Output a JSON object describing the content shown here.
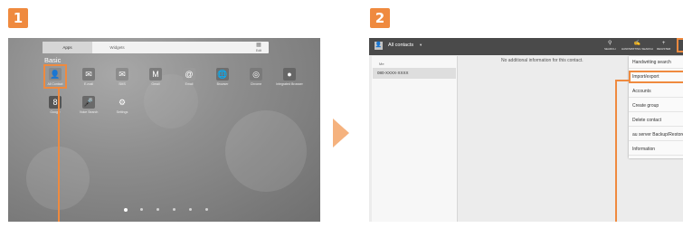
{
  "steps": [
    "1",
    "2"
  ],
  "home": {
    "tabs": [
      {
        "label": "Apps",
        "active": true
      },
      {
        "label": "Widgets",
        "active": false
      }
    ],
    "edit_label": "Edit",
    "section": "Basic",
    "apps_row1": [
      {
        "label": "All Contact",
        "icon": "contacts-icon",
        "glyph": "👤",
        "color": "#8a8a8a"
      },
      {
        "label": "E-mail",
        "icon": "email-icon",
        "glyph": "✉",
        "color": "#7a7a7a"
      },
      {
        "label": "SMS",
        "icon": "sms-icon",
        "glyph": "✉",
        "color": "#8c8c8c"
      },
      {
        "label": "Gmail",
        "icon": "gmail-icon",
        "glyph": "M",
        "color": "#7c7c7c"
      },
      {
        "label": "Email",
        "icon": "mail-icon",
        "glyph": "@",
        "color": "#9a9a9a"
      },
      {
        "label": "Browser",
        "icon": "browser-icon",
        "glyph": "🌐",
        "color": "#6e6e6e"
      },
      {
        "label": "Chrome",
        "icon": "chrome-icon",
        "glyph": "◎",
        "color": "#7a7a7a"
      },
      {
        "label": "Integrated Browser",
        "icon": "integrated-browser-icon",
        "glyph": "●",
        "color": "#666666"
      }
    ],
    "apps_row2": [
      {
        "label": "Google",
        "icon": "google-icon",
        "glyph": "8",
        "color": "#555555"
      },
      {
        "label": "Voice Search",
        "icon": "voice-search-icon",
        "glyph": "🎤",
        "color": "#6a6a6a"
      },
      {
        "label": "Settings",
        "icon": "settings-icon",
        "glyph": "⚙",
        "color": "transparent"
      }
    ],
    "page_dots": 6,
    "active_page": 0
  },
  "contacts": {
    "group": "All contacts",
    "actions": [
      {
        "label": "SEARCH",
        "icon": "search-icon",
        "glyph": "⚲"
      },
      {
        "label": "HANDWRITING SEARCH",
        "icon": "handwriting-icon",
        "glyph": "✍"
      },
      {
        "label": "REGISTER",
        "icon": "add-contact-icon",
        "glyph": "👤"
      }
    ],
    "list_header": "Me",
    "my_number": "080-XXXX-XXXX",
    "detail_message": "No additional information for this contact.",
    "menu_items": [
      "Handwriting search",
      "Import/export",
      "Accounts",
      "Create group",
      "Delete contact",
      "au server Backup/Restore",
      "Information"
    ],
    "highlighted_menu_item": 1
  },
  "colors": {
    "accent": "#ef8a3f",
    "arrow": "#f5b27e"
  }
}
